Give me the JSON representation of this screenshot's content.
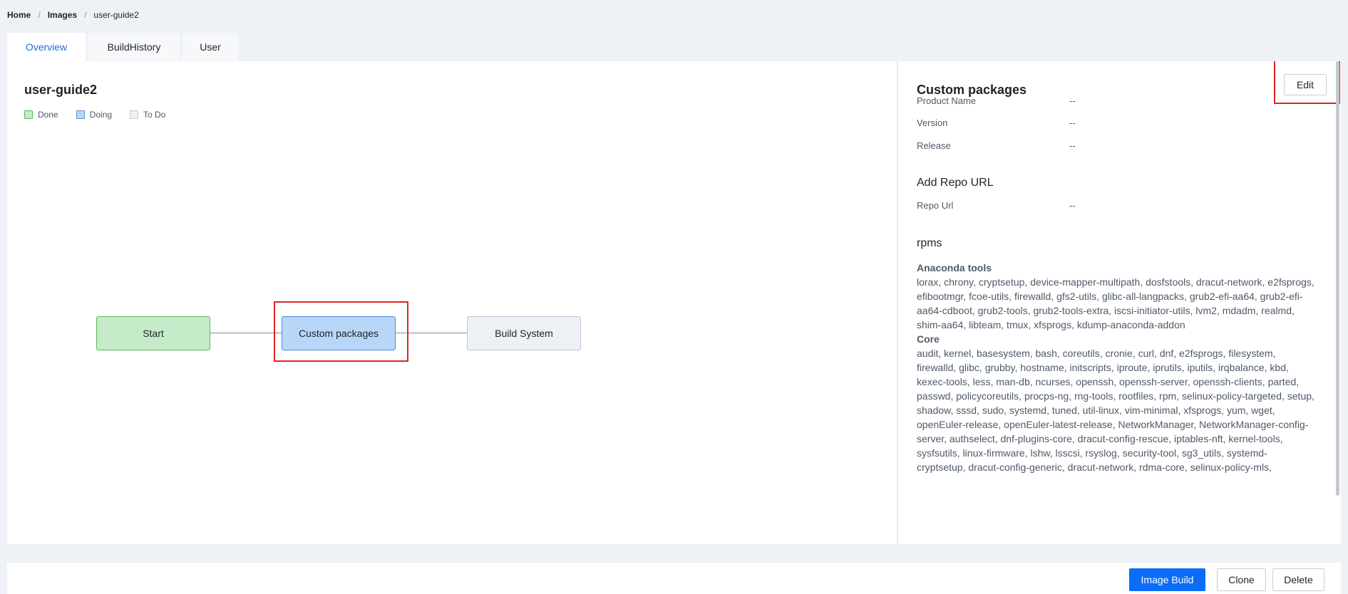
{
  "breadcrumb": {
    "items": [
      "Home",
      "Images",
      "user-guide2"
    ],
    "separator": "/"
  },
  "tabs": [
    {
      "label": "Overview",
      "active": true
    },
    {
      "label": "BuildHistory",
      "active": false
    },
    {
      "label": "User",
      "active": false
    }
  ],
  "overview": {
    "title": "user-guide2",
    "legend": {
      "done": "Done",
      "doing": "Doing",
      "todo": "To Do"
    },
    "colors": {
      "done": "#c5ebc8",
      "doing": "#b8d6f7",
      "todo": "#edf0f5",
      "highlight": "#e02424"
    },
    "flow": [
      {
        "label": "Start",
        "status": "done"
      },
      {
        "label": "Custom packages",
        "status": "doing"
      },
      {
        "label": "Build System",
        "status": "todo"
      }
    ]
  },
  "details": {
    "title": "Custom packages",
    "edit_label": "Edit",
    "fields": [
      {
        "label": "Product Name",
        "value": "--"
      },
      {
        "label": "Version",
        "value": "--"
      },
      {
        "label": "Release",
        "value": "--"
      }
    ],
    "repo_section_title": "Add Repo URL",
    "repo": {
      "label": "Repo Url",
      "value": "--"
    },
    "rpms_title": "rpms",
    "groups": [
      {
        "name": "Anaconda tools",
        "packages": "lorax, chrony, cryptsetup, device-mapper-multipath, dosfstools, dracut-network, e2fsprogs, efibootmgr, fcoe-utils, firewalld, gfs2-utils, glibc-all-langpacks, grub2-efi-aa64, grub2-efi-aa64-cdboot, grub2-tools, grub2-tools-extra, iscsi-initiator-utils, lvm2, mdadm, realmd, shim-aa64, libteam, tmux, xfsprogs, kdump-anaconda-addon"
      },
      {
        "name": "Core",
        "packages": "audit, kernel, basesystem, bash, coreutils, cronie, curl, dnf, e2fsprogs, filesystem, firewalld, glibc, grubby, hostname, initscripts, iproute, iprutils, iputils, irqbalance, kbd, kexec-tools, less, man-db, ncurses, openssh, openssh-server, openssh-clients, parted, passwd, policycoreutils, procps-ng, rng-tools, rootfiles, rpm, selinux-policy-targeted, setup, shadow, sssd, sudo, systemd, tuned, util-linux, vim-minimal, xfsprogs, yum, wget, openEuler-release, openEuler-latest-release, NetworkManager, NetworkManager-config-server, authselect, dnf-plugins-core, dracut-config-rescue, iptables-nft, kernel-tools, sysfsutils, linux-firmware, lshw, lsscsi, rsyslog, security-tool, sg3_utils, systemd-cryptsetup, dracut-config-generic, dracut-network, rdma-core, selinux-policy-mls,"
      }
    ]
  },
  "actions": {
    "build_label": "Image Build",
    "clone_label": "Clone",
    "delete_label": "Delete"
  }
}
